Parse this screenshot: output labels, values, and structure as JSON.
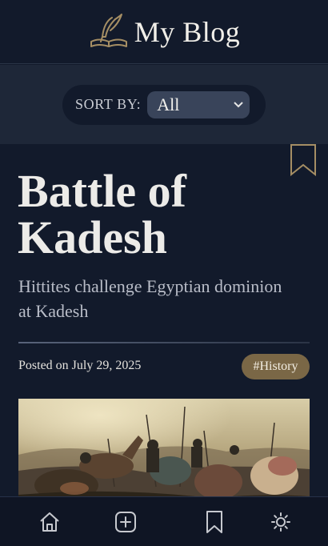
{
  "header": {
    "title": "My Blog",
    "logo_icon": "quill-book-icon"
  },
  "sort": {
    "label": "SORT BY:",
    "selected": "All"
  },
  "post": {
    "title": "Battle of Kadesh",
    "subtitle": "Hittites challenge Egyptian dominion at Kadesh",
    "posted_on": "Posted on July 29, 2025",
    "tag": "#History",
    "bookmark_icon": "bookmark-outline-icon",
    "image": "battle-scene-painting"
  },
  "nav": {
    "items": [
      {
        "icon": "home-icon"
      },
      {
        "icon": "add-post-icon"
      },
      {
        "icon": "bookmark-icon"
      },
      {
        "icon": "theme-toggle-icon"
      }
    ]
  },
  "colors": {
    "background": "#121a2b",
    "sortbar": "#1e2738",
    "accent_gold": "#a58e64",
    "tag_bg": "#7a6746",
    "select_bg": "#39445a"
  }
}
